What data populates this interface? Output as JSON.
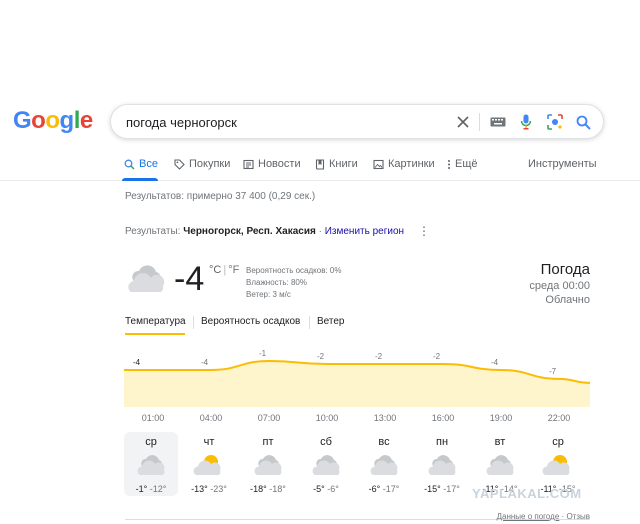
{
  "logo": {
    "letters": [
      "G",
      "o",
      "o",
      "g",
      "l",
      "e"
    ],
    "colors": [
      "#4285f4",
      "#ea4335",
      "#fbbc05",
      "#4285f4",
      "#34a853",
      "#ea4335"
    ]
  },
  "search": {
    "query": "погода черногорск"
  },
  "tabs": [
    {
      "label": "Все",
      "icon": "search-icon"
    },
    {
      "label": "Покупки",
      "icon": "tag-icon"
    },
    {
      "label": "Новости",
      "icon": "newspaper-icon"
    },
    {
      "label": "Книги",
      "icon": "book-icon"
    },
    {
      "label": "Картинки",
      "icon": "image-icon"
    },
    {
      "label": "Ещё",
      "icon": "more-vert-icon"
    },
    {
      "label": "Инструменты"
    }
  ],
  "results_count": "Результатов: примерно 37 400 (0,29 сек.)",
  "region": {
    "prefix": "Результаты:",
    "place": "Черногорск, Респ. Хакасия",
    "dot": "·",
    "change_link": "Изменить регион"
  },
  "weather": {
    "temp": "-4",
    "unit_c": "°C",
    "unit_sep": "|",
    "unit_f": "°F",
    "precip": "Вероятность осадков: 0%",
    "humidity": "Влажность: 80%",
    "wind": "Ветер: 3 м/с",
    "title": "Погода",
    "time": "среда 00:00",
    "condition": "Облачно",
    "accent": "#fbbc04",
    "fill": "#fff5cc"
  },
  "weather_tabs": [
    "Температура",
    "Вероятность осадков",
    "Ветер"
  ],
  "temp_chart": {
    "type": "area",
    "labels": [
      "-4",
      "-4",
      "-1",
      "-2",
      "-2",
      "-2",
      "-4",
      "-7"
    ],
    "values": [
      -4,
      -4,
      -1,
      -2,
      -2,
      -2,
      -4,
      -7
    ]
  },
  "hours": [
    "01:00",
    "04:00",
    "07:00",
    "10:00",
    "13:00",
    "16:00",
    "19:00",
    "22:00"
  ],
  "days": [
    {
      "name": "ср",
      "hi": "-1°",
      "lo": "-12°",
      "icon": "cloud-icon"
    },
    {
      "name": "чт",
      "hi": "-13°",
      "lo": "-23°",
      "icon": "partly-sunny-icon"
    },
    {
      "name": "пт",
      "hi": "-18°",
      "lo": "-18°",
      "icon": "cloud-icon"
    },
    {
      "name": "сб",
      "hi": "-5°",
      "lo": "-6°",
      "icon": "cloud-icon"
    },
    {
      "name": "вс",
      "hi": "-6°",
      "lo": "-17°",
      "icon": "cloud-icon"
    },
    {
      "name": "пн",
      "hi": "-15°",
      "lo": "-17°",
      "icon": "cloud-icon"
    },
    {
      "name": "вт",
      "hi": "-11°",
      "lo": "-14°",
      "icon": "cloud-icon"
    },
    {
      "name": "ср",
      "hi": "-11°",
      "lo": "-15°",
      "icon": "partly-sunny-icon"
    }
  ],
  "footer": {
    "data_link": "Данные о погоде",
    "dot": "·",
    "feedback": "Отзыв"
  },
  "watermark": "YAPLAKAL.COM"
}
